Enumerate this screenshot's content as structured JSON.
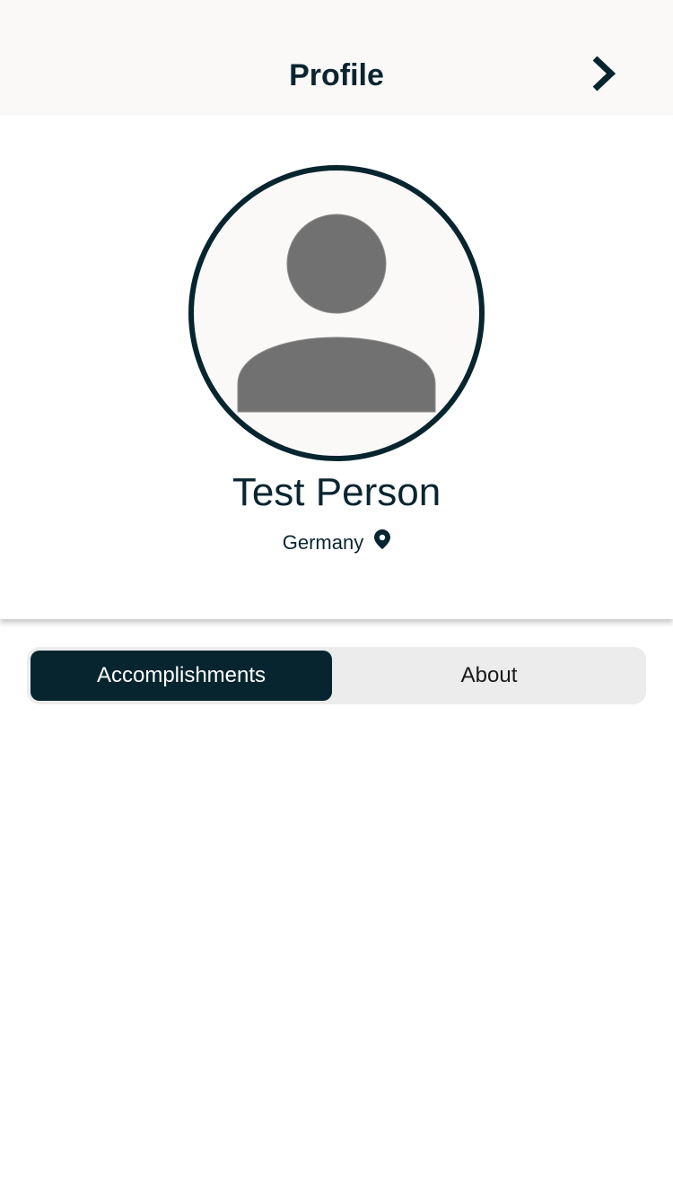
{
  "header": {
    "title": "Profile",
    "next_icon": "chevron-right-icon"
  },
  "profile": {
    "avatar_icon": "person-silhouette-icon",
    "name": "Test Person",
    "location": "Germany",
    "location_icon": "map-pin-icon"
  },
  "tabs": {
    "items": [
      {
        "label": "Accomplishments",
        "selected": true
      },
      {
        "label": "About",
        "selected": false
      }
    ]
  },
  "colors": {
    "primary": "#06252f",
    "header_bg": "#faf9f8",
    "segment_bg": "#ececec",
    "avatar_fill": "#717171"
  }
}
